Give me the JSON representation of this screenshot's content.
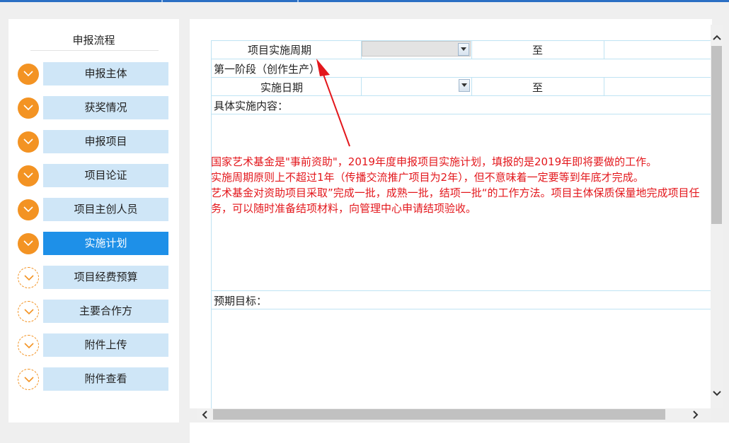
{
  "sidebar": {
    "title": "申报流程",
    "steps": [
      {
        "label": "申报主体",
        "status": "done"
      },
      {
        "label": "获奖情况",
        "status": "done"
      },
      {
        "label": "申报项目",
        "status": "done"
      },
      {
        "label": "项目论证",
        "status": "done"
      },
      {
        "label": "项目主创人员",
        "status": "done"
      },
      {
        "label": "实施计划",
        "status": "current"
      },
      {
        "label": "项目经费预算",
        "status": "todo"
      },
      {
        "label": "主要合作方",
        "status": "todo"
      },
      {
        "label": "附件上传",
        "status": "todo"
      },
      {
        "label": "附件查看",
        "status": "todo"
      }
    ]
  },
  "form": {
    "period_label": "项目实施周期",
    "period_to": "至",
    "stage_label": "第一阶段（创作生产）",
    "date_label": "实施日期",
    "date_to": "至",
    "content_label": "具体实施内容：",
    "target_label": "预期目标："
  },
  "annotation": {
    "line1": "国家艺术基金是\"事前资助\"，2019年度申报项目实施计划，填报的是2019年即将要做的工作。",
    "line2": "实施周期原则上不超过1年（传播交流推广项目为2年），但不意味着一定要等到年底才完成。",
    "line3": "艺术基金对资助项目采取”完成一批，成熟一批，结项一批“的工作方法。项目主体保质保量地完成项目任务，可以随时准备结项材料，向管理中心申请结项验收。",
    "color": "#e3171c"
  },
  "colors": {
    "step_done": "#f39323",
    "step_button": "#cfe6f7",
    "step_active": "#1e90e8",
    "border": "#bfe3f3"
  },
  "icons": {
    "step_done": "chevron-down-icon",
    "select": "dropdown-arrow-icon",
    "scroll_up": "chevron-up-icon",
    "scroll_down": "chevron-down-icon",
    "scroll_left": "chevron-left-icon",
    "scroll_right": "chevron-right-icon"
  }
}
